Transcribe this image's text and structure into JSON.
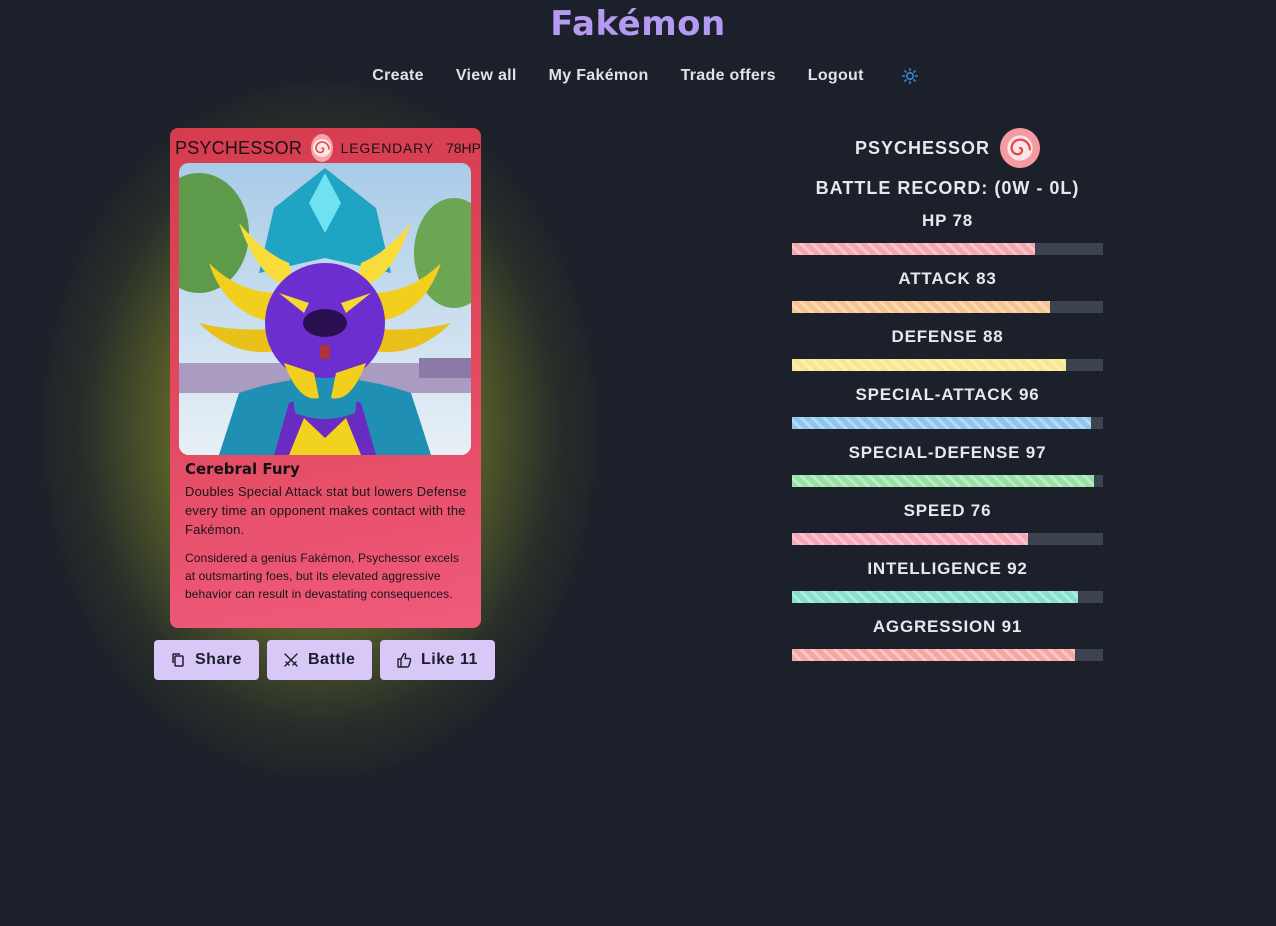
{
  "app": {
    "title": "Fakémon"
  },
  "nav": {
    "items": [
      "Create",
      "View all",
      "My Fakémon",
      "Trade offers",
      "Logout"
    ],
    "theme_icon": "sun-icon"
  },
  "card": {
    "name": "PSYCHESSOR",
    "type_icon": "psychic-swirl-icon",
    "rarity": "LEGENDARY",
    "hp": "78HP",
    "ability_name": "Cerebral Fury",
    "ability_desc": "Doubles Special Attack stat but lowers Defense every time an opponent makes contact with the Fakémon.",
    "flavor": "Considered a genius Fakémon, Psychessor excels at outsmarting foes, but its elevated aggressive behavior can result in devastating consequences.",
    "colors": {
      "card": "#e2495f",
      "glow": "#bec828"
    }
  },
  "actions": {
    "share_label": "Share",
    "battle_label": "Battle",
    "like_label": "Like 11"
  },
  "stats": {
    "name": "PSYCHESSOR",
    "battle_record": "BATTLE RECORD: (0W - 0L)",
    "max": 100,
    "items": [
      {
        "label": "HP 78",
        "value": 78,
        "color": "#f4a7ae"
      },
      {
        "label": "ATTACK 83",
        "value": 83,
        "color": "#f6c48e"
      },
      {
        "label": "DEFENSE 88",
        "value": 88,
        "color": "#f7e78e"
      },
      {
        "label": "SPECIAL-ATTACK 96",
        "value": 96,
        "color": "#8ec6ee"
      },
      {
        "label": "SPECIAL-DEFENSE 97",
        "value": 97,
        "color": "#98e0a4"
      },
      {
        "label": "SPEED 76",
        "value": 76,
        "color": "#f6a7b8"
      },
      {
        "label": "INTELLIGENCE 92",
        "value": 92,
        "color": "#86e0cc"
      },
      {
        "label": "AGGRESSION 91",
        "value": 91,
        "color": "#f6a7a4"
      }
    ]
  }
}
